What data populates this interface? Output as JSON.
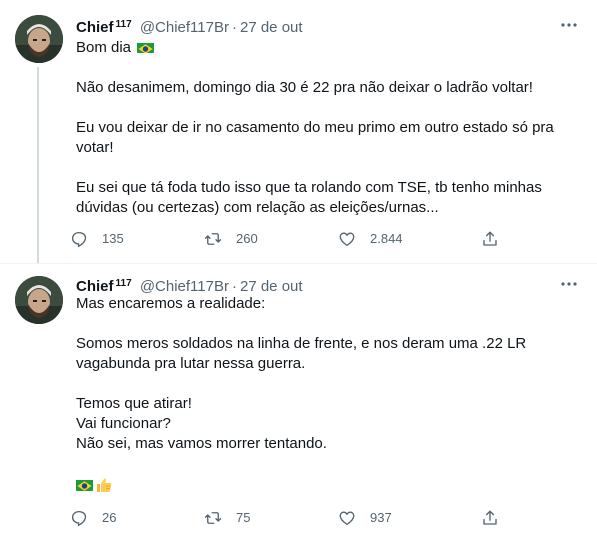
{
  "colors": {
    "text": "#0f1419",
    "muted": "#536471",
    "divider": "#eff3f4",
    "thread": "#cfd9de"
  },
  "tweets": [
    {
      "author": {
        "name": "Chief",
        "superscript": "117",
        "handle": "@Chief117Br"
      },
      "date": "27 de out",
      "greeting": "Bom dia",
      "paragraphs": [
        "Não desanimem, domingo dia 30 é 22 pra não deixar o ladrão voltar!",
        "Eu vou deixar de ir no casamento do meu primo em outro estado só pra votar!",
        "Eu sei que tá foda tudo isso que ta rolando com TSE, tb tenho minhas dúvidas (ou certezas) com relação as eleições/urnas..."
      ],
      "stats": {
        "replies": "135",
        "retweets": "260",
        "likes": "2.844"
      }
    },
    {
      "author": {
        "name": "Chief",
        "superscript": "117",
        "handle": "@Chief117Br"
      },
      "date": "27 de out",
      "paragraphs": [
        "Mas encaremos a realidade:",
        "Somos meros soldados na linha de frente, e nos deram uma .22 LR vagabunda pra lutar nessa guerra.",
        "Temos que atirar!\nVai funcionar?\nNão sei, mas vamos morrer tentando."
      ],
      "emoji_icons": [
        "brazil-flag-icon",
        "thumbs-up-icon"
      ],
      "stats": {
        "replies": "26",
        "retweets": "75",
        "likes": "937"
      }
    }
  ]
}
